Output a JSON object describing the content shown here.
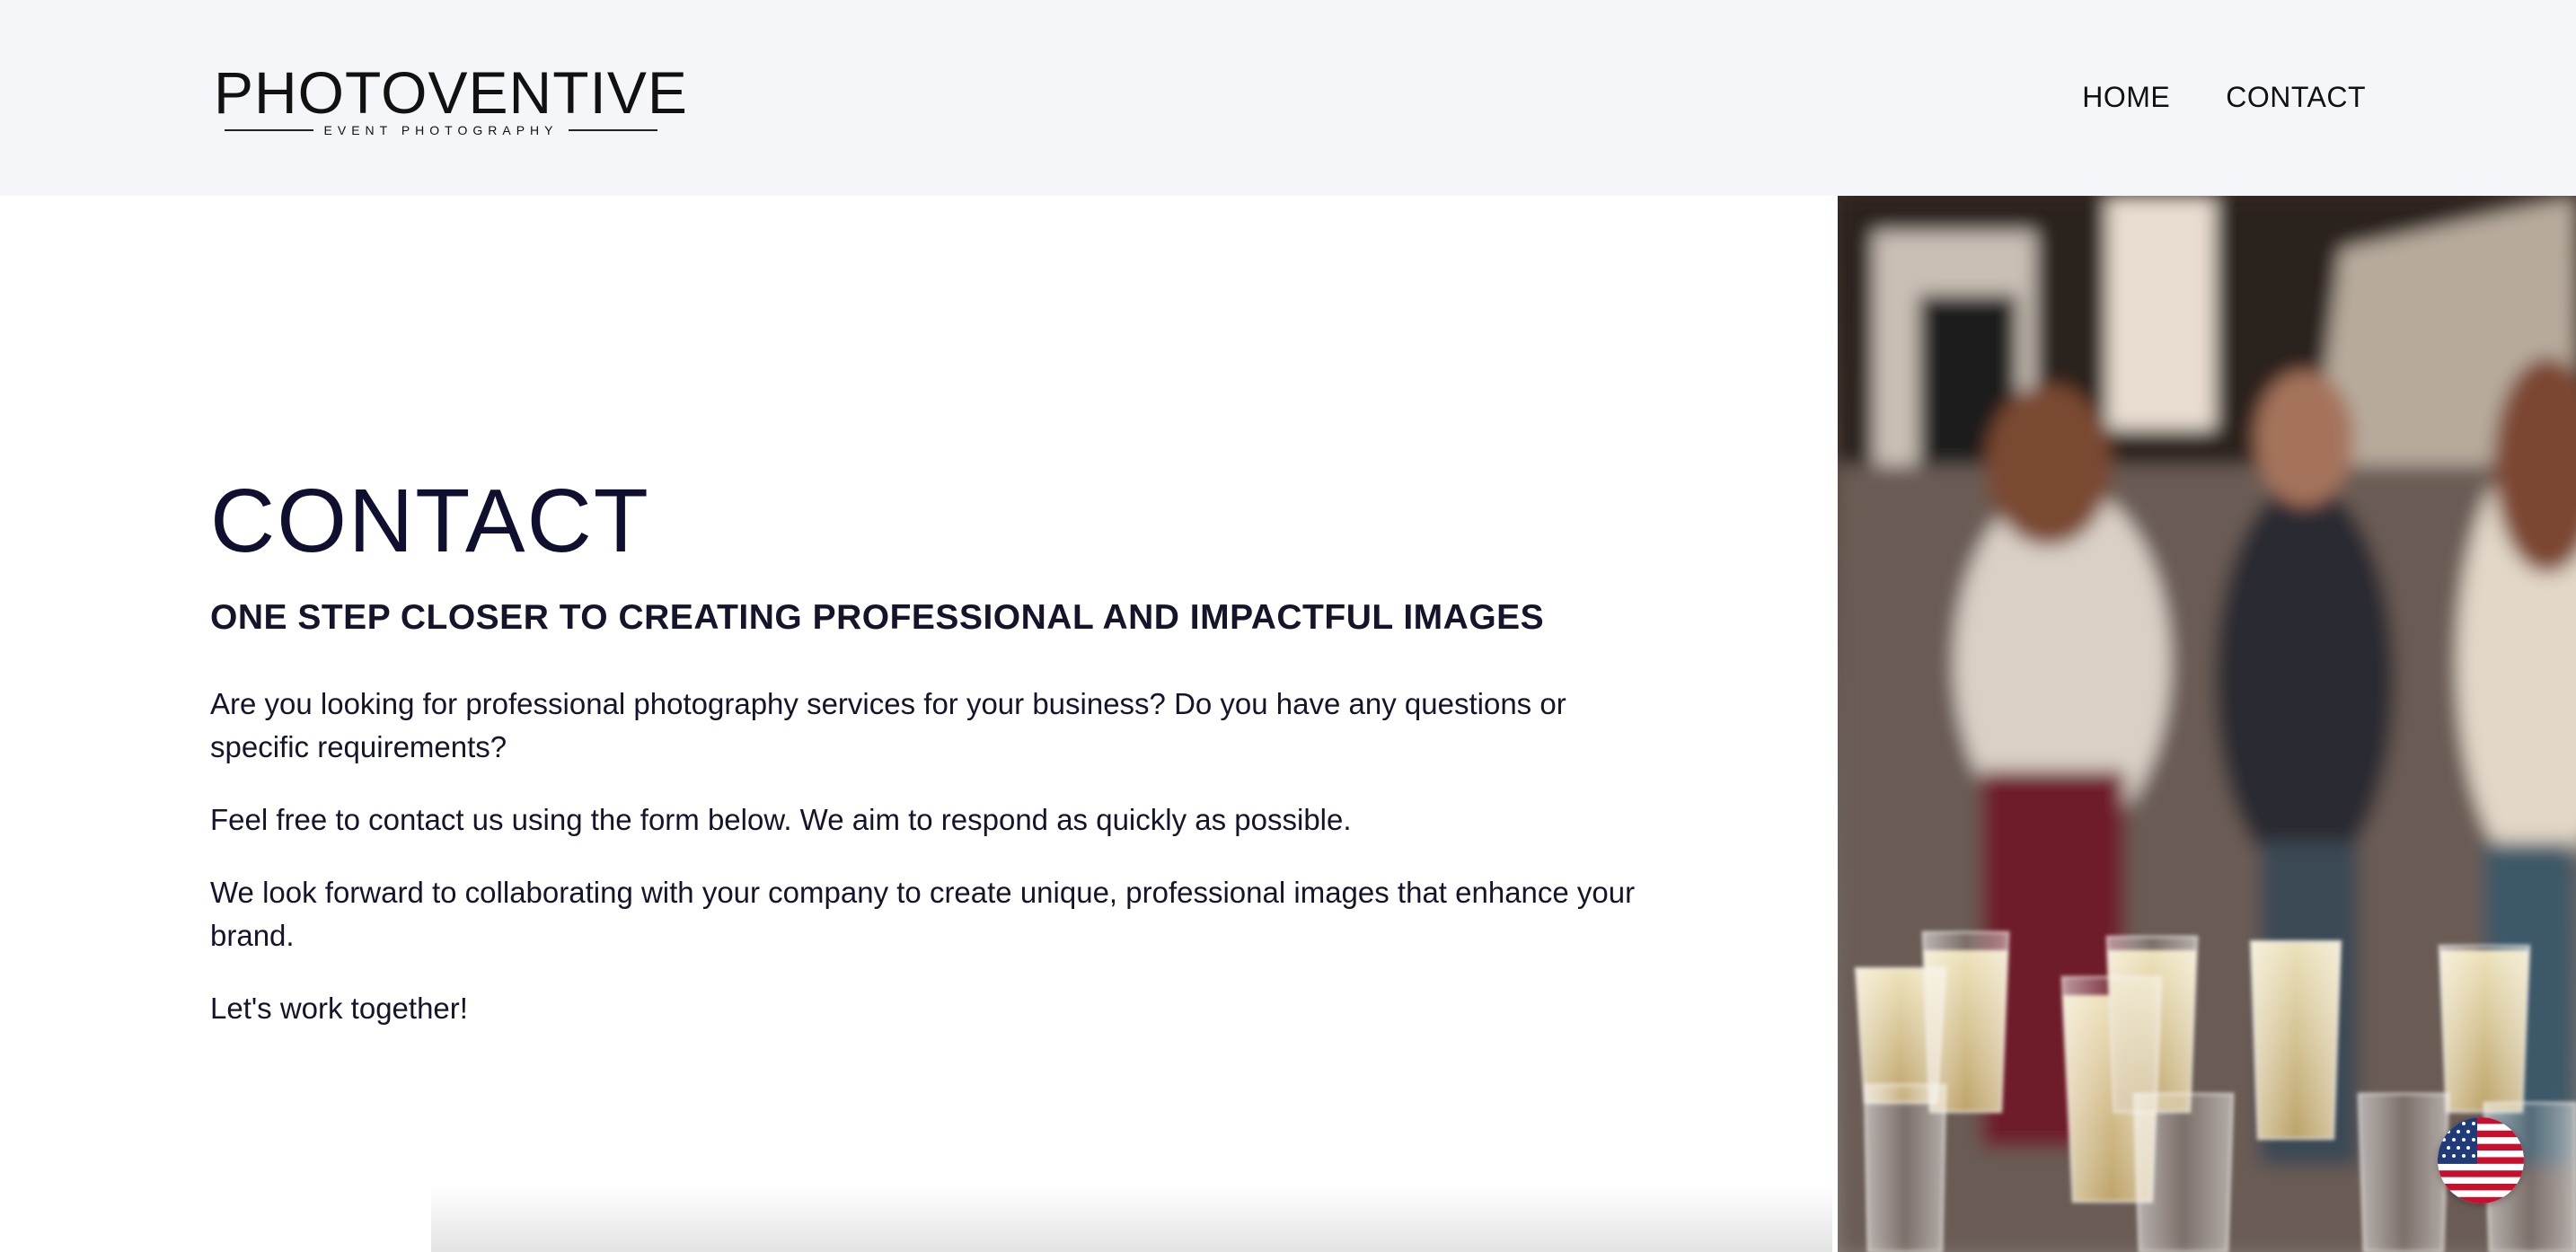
{
  "header": {
    "logo_text": "PHOTOVENTIVE",
    "logo_subtext": "EVENT PHOTOGRAPHY",
    "nav": [
      {
        "label": "HOME"
      },
      {
        "label": "CONTACT"
      }
    ]
  },
  "main": {
    "title": "CONTACT",
    "subtitle": "ONE STEP CLOSER TO CREATING PROFESSIONAL AND IMPACTFUL IMAGES",
    "paragraphs": [
      "Are you looking for professional photography services for your business? Do you have any questions or specific requirements?",
      "Feel free to contact us using the form below. We aim to respond as quickly as possible.",
      "We look forward to collaborating with your company to create unique, professional images that enhance your brand.",
      "Let's work together!"
    ]
  },
  "icons": {
    "language": "us-flag-icon"
  },
  "colors": {
    "header_bg": "#f5f6fa",
    "title": "#0f1030",
    "text": "#14142b"
  }
}
